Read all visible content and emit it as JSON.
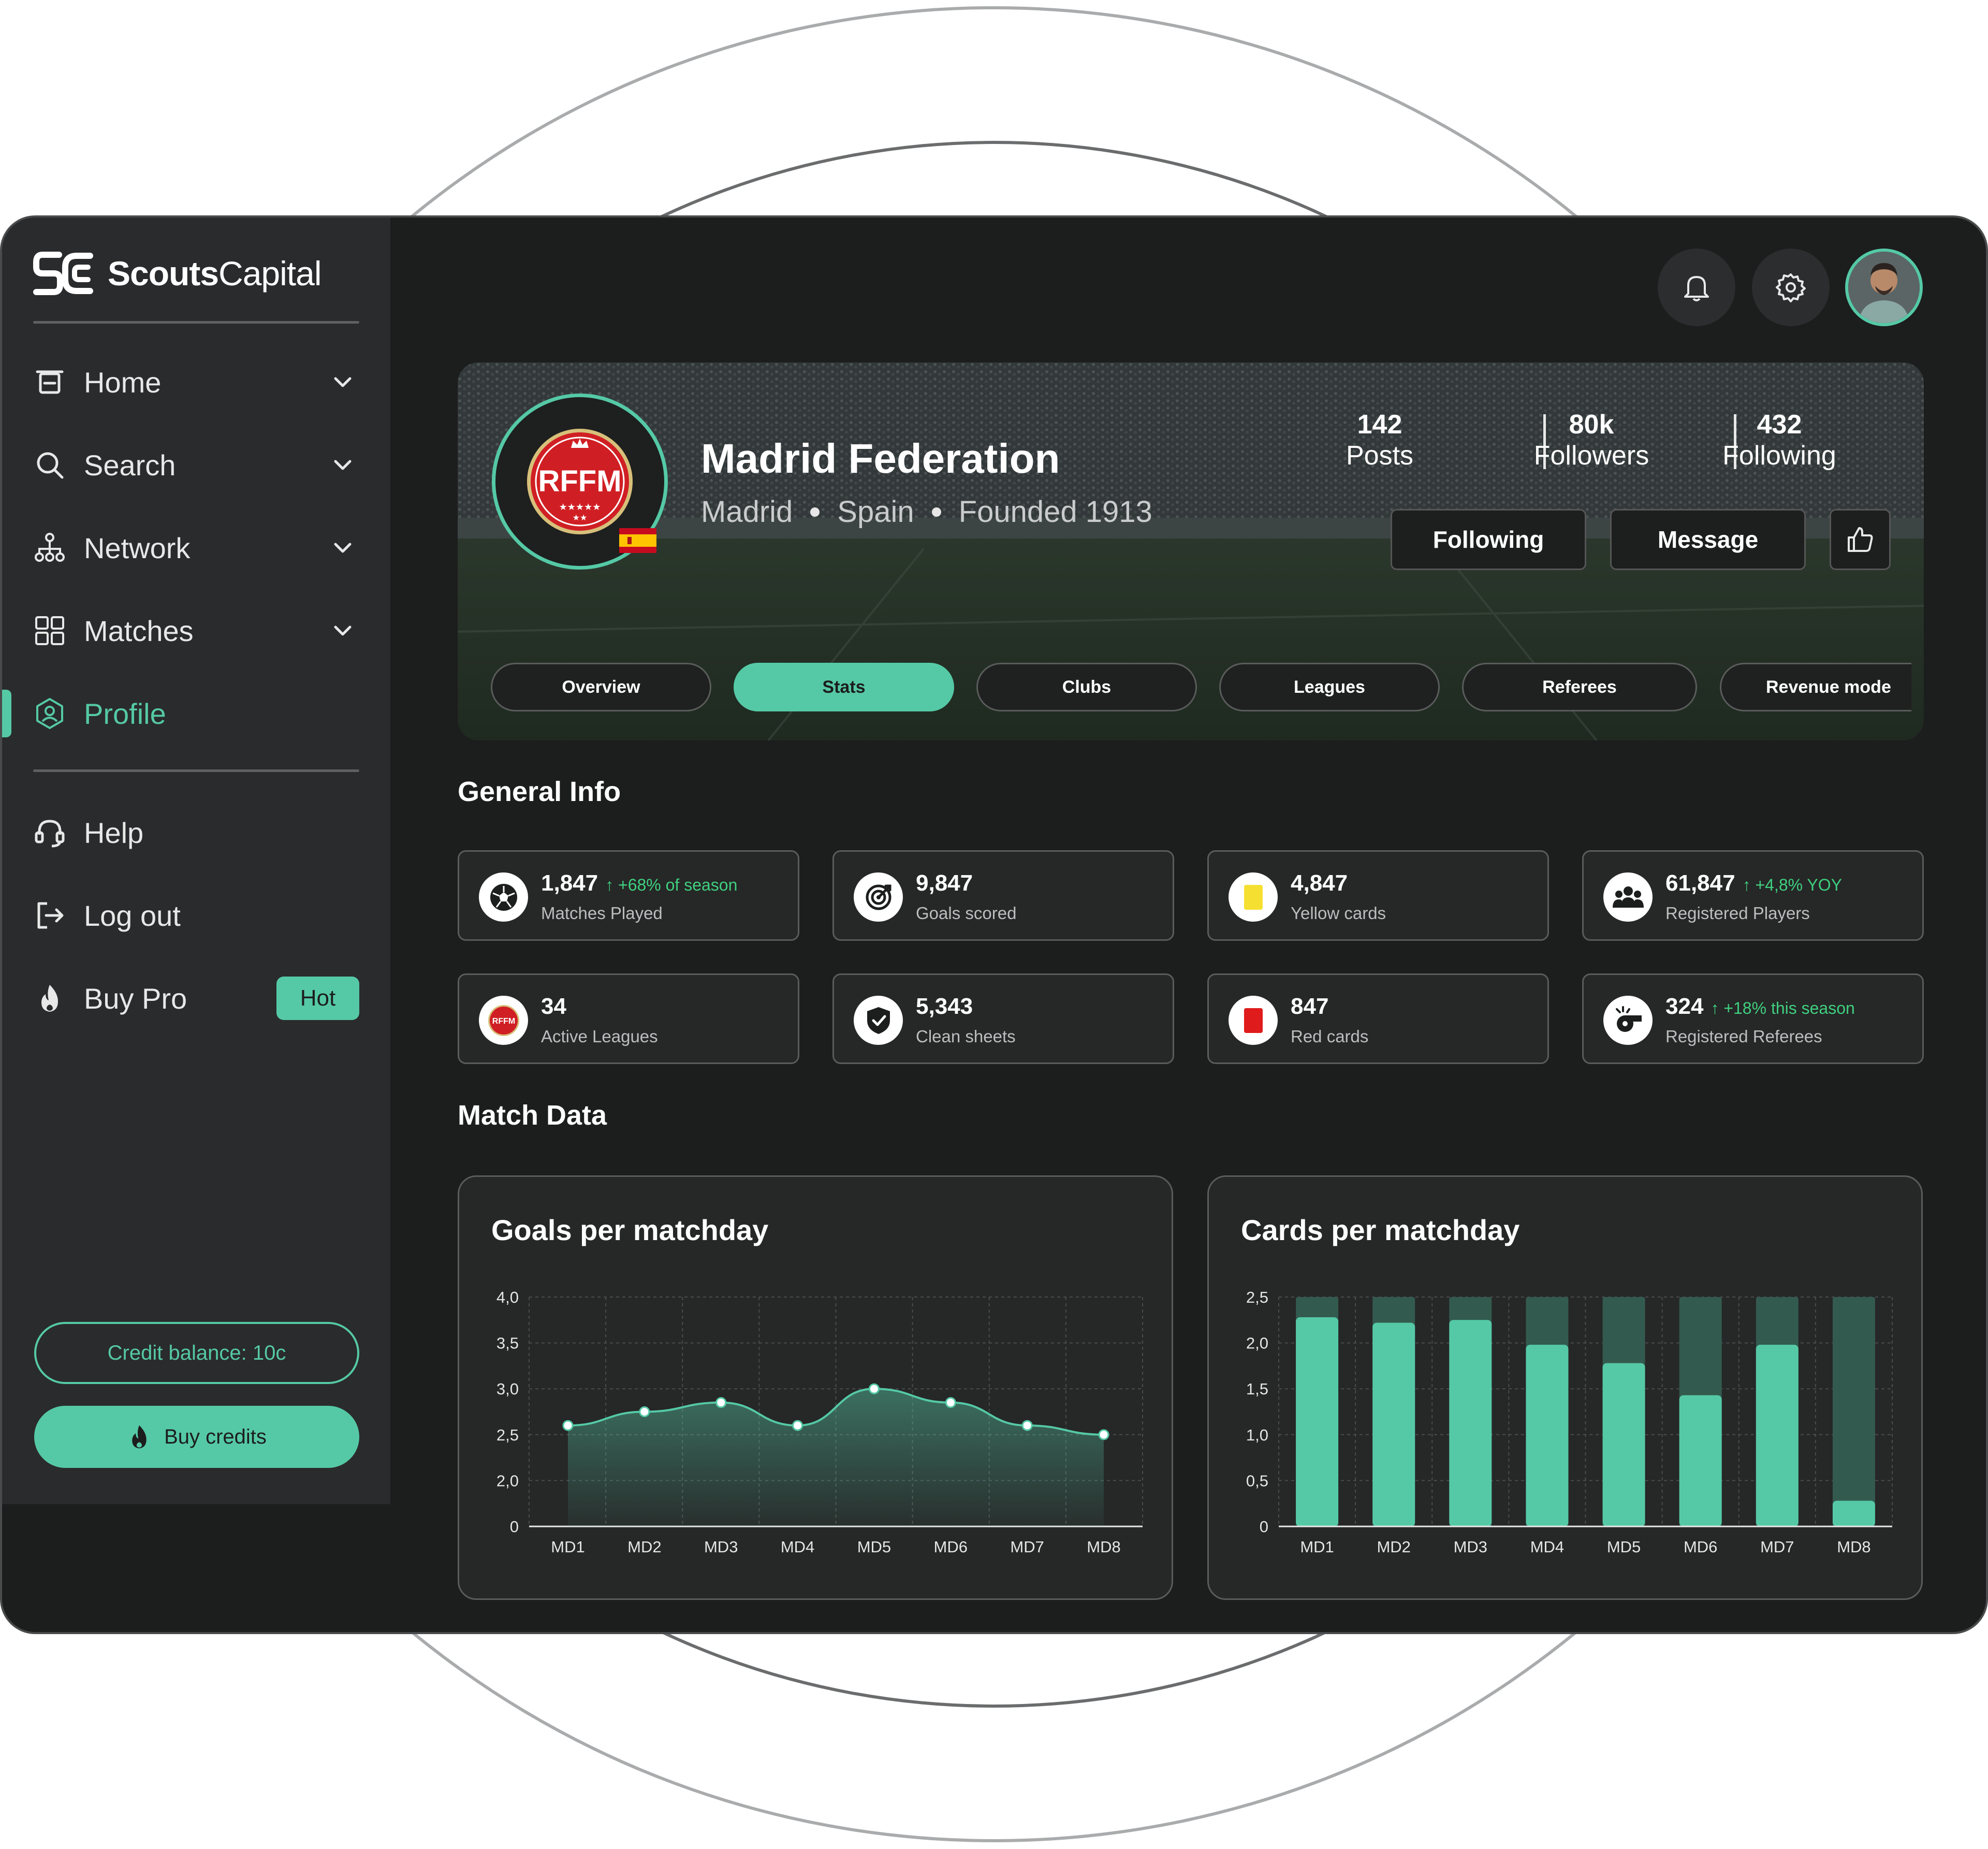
{
  "brand": {
    "name_bold": "Scouts",
    "name_light": "Capital"
  },
  "sidebar": {
    "items": [
      {
        "label": "Home",
        "icon": "home-icon"
      },
      {
        "label": "Search",
        "icon": "search-icon"
      },
      {
        "label": "Network",
        "icon": "network-icon"
      },
      {
        "label": "Matches",
        "icon": "grid-icon"
      },
      {
        "label": "Profile",
        "icon": "profile-icon"
      }
    ],
    "secondary": [
      {
        "label": "Help",
        "icon": "headset-icon"
      },
      {
        "label": "Log out",
        "icon": "logout-icon"
      },
      {
        "label": "Buy Pro",
        "icon": "flame-icon",
        "badge": "Hot"
      }
    ],
    "credit_balance": "Credit balance: 10c",
    "buy_credits": "Buy credits"
  },
  "header": {
    "icons": [
      "bell-icon",
      "gear-icon",
      "avatar"
    ]
  },
  "profile": {
    "logo_text": "RFFM",
    "name": "Madrid Federation",
    "city": "Madrid",
    "country": "Spain",
    "founded": "Founded 1913",
    "stats": [
      {
        "value": "142",
        "label": "Posts"
      },
      {
        "value": "80k",
        "label": "Followers"
      },
      {
        "value": "432",
        "label": "Following"
      }
    ],
    "following_button": "Following",
    "message_button": "Message",
    "tabs": [
      "Overview",
      "Stats",
      "Clubs",
      "Leagues",
      "Referees",
      "Revenue mode"
    ]
  },
  "general_info": {
    "title": "General Info",
    "cards": [
      {
        "value": "1,847",
        "delta": "+68% of season",
        "label": "Matches Played",
        "icon": "soccer-ball-icon"
      },
      {
        "value": "9,847",
        "delta": "",
        "label": "Goals scored",
        "icon": "target-icon"
      },
      {
        "value": "4,847",
        "delta": "",
        "label": "Yellow cards",
        "icon": "yellow-card-icon"
      },
      {
        "value": "61,847",
        "delta": "+4,8% YOY",
        "label": "Registered Players",
        "icon": "players-icon"
      },
      {
        "value": "34",
        "delta": "",
        "label": "Active Leagues",
        "icon": "league-logo-icon"
      },
      {
        "value": "5,343",
        "delta": "",
        "label": "Clean sheets",
        "icon": "shield-check-icon"
      },
      {
        "value": "847",
        "delta": "",
        "label": "Red cards",
        "icon": "red-card-icon"
      },
      {
        "value": "324",
        "delta": "+18% this season",
        "label": "Registered Referees",
        "icon": "whistle-icon"
      }
    ]
  },
  "match_data": {
    "title": "Match Data"
  },
  "colors": {
    "accent": "#55c9a6",
    "positive": "#3fd07f",
    "background": "#1c1d1d",
    "panel": "#2a2b2c"
  },
  "chart_data": [
    {
      "type": "area",
      "title": "Goals per matchday",
      "categories": [
        "MD1",
        "MD2",
        "MD3",
        "MD4",
        "MD5",
        "MD6",
        "MD7",
        "MD8"
      ],
      "values": [
        2.6,
        2.75,
        2.85,
        2.6,
        3.0,
        2.85,
        2.6,
        2.5
      ],
      "yticks": [
        "0",
        "2,0",
        "2,5",
        "3,0",
        "3,5",
        "4,0"
      ],
      "grid": true
    },
    {
      "type": "bar",
      "title": "Cards per matchday",
      "categories": [
        "MD1",
        "MD2",
        "MD3",
        "MD4",
        "MD5",
        "MD6",
        "MD7",
        "MD8"
      ],
      "values": [
        2.28,
        2.22,
        2.25,
        1.98,
        1.78,
        1.43,
        1.98,
        0.28
      ],
      "max_track": 2.5,
      "yticks": [
        "0",
        "0,5",
        "1,0",
        "1,5",
        "2,0",
        "2,5"
      ],
      "ylim": [
        0,
        2.5
      ],
      "grid": true
    }
  ]
}
